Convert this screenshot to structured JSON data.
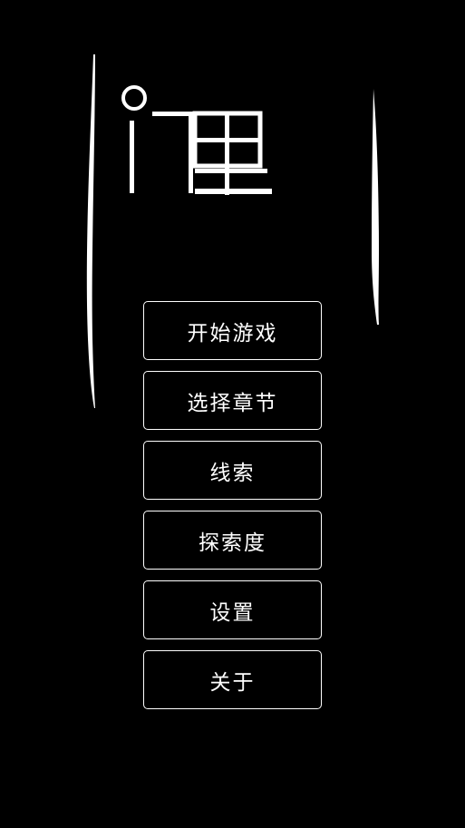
{
  "logo": {
    "icon": "door-inside-logo",
    "color": "#ffffff"
  },
  "menu": {
    "items": [
      {
        "id": "start-game",
        "label": "开始游戏"
      },
      {
        "id": "select-chapter",
        "label": "选择章节"
      },
      {
        "id": "clues",
        "label": "线索"
      },
      {
        "id": "exploration",
        "label": "探索度"
      },
      {
        "id": "settings",
        "label": "设置"
      },
      {
        "id": "about",
        "label": "关于"
      }
    ]
  },
  "colors": {
    "background": "#000000",
    "foreground": "#ffffff"
  }
}
